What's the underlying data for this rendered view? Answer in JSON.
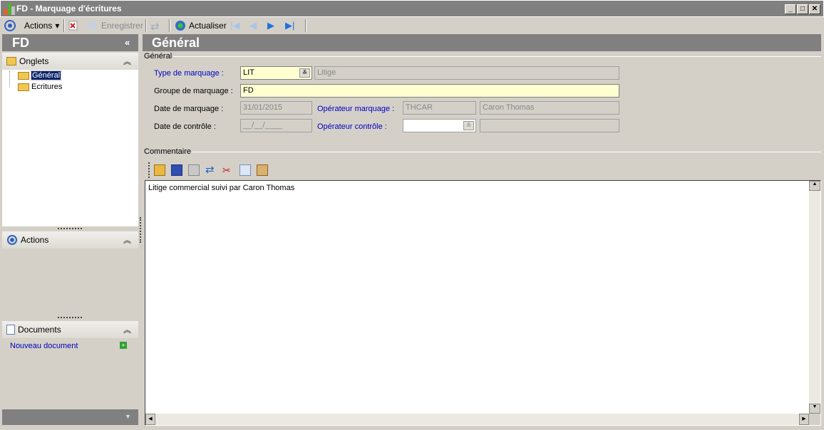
{
  "window": {
    "title": "FD -  Marquage d'écritures"
  },
  "toolbar": {
    "actions": "Actions",
    "save": "Enregistrer",
    "refresh": "Actualiser"
  },
  "left": {
    "title": "FD",
    "collapse": "«",
    "tabs_section": "Onglets",
    "tabs": [
      "Général",
      "Ecritures"
    ],
    "actions_section": "Actions",
    "documents_section": "Documents",
    "new_document": "Nouveau document"
  },
  "main": {
    "title": "Général",
    "group": "Général",
    "type_label": "Type de marquage :",
    "type_value": "LIT",
    "type_desc": "Litige",
    "groupe_label": "Groupe de marquage :",
    "groupe_value": "FD",
    "date_marq_label": "Date de marquage :",
    "date_marq_value": "31/01/2015",
    "op_marq_label": "Opérateur marquage :",
    "op_marq_code": "THCAR",
    "op_marq_name": "Caron Thomas",
    "date_ctrl_label": "Date de contrôle :",
    "date_ctrl_value": "__/__/____",
    "op_ctrl_label": "Opérateur contrôle :",
    "op_ctrl_code": "",
    "op_ctrl_name": "",
    "comment_group": "Commentaire",
    "comment_text": "Litige commercial suivi par Caron Thomas"
  }
}
